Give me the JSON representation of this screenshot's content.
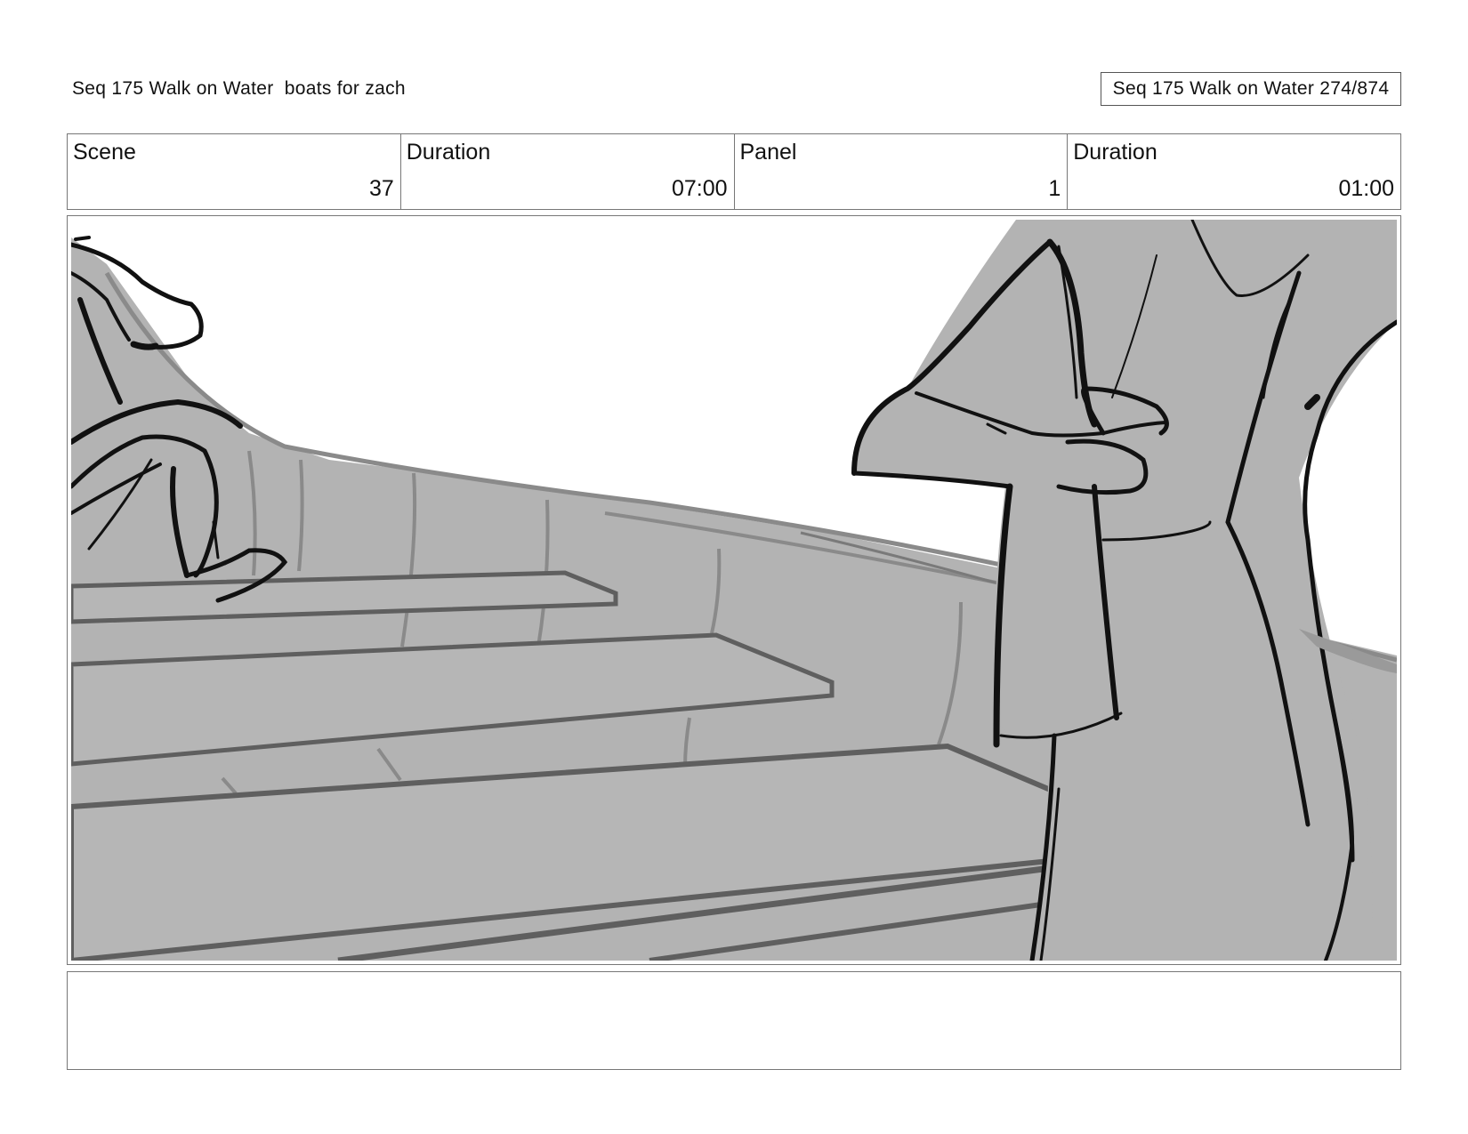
{
  "header": {
    "title": "Seq 175 Walk on Water  boats for zach",
    "page_ref": "Seq 175 Walk on Water 274/874"
  },
  "info": {
    "scene_label": "Scene",
    "scene_value": "37",
    "scene_duration_label": "Duration",
    "scene_duration_value": "07:00",
    "panel_label": "Panel",
    "panel_value": "1",
    "panel_duration_label": "Duration",
    "panel_duration_value": "01:00"
  },
  "notes": {
    "text": ""
  },
  "colors": {
    "sketch_fill": "#b3b3b3",
    "sketch_line": "#111111",
    "sketch_mid": "#6a6a6a",
    "border": "#777777"
  }
}
